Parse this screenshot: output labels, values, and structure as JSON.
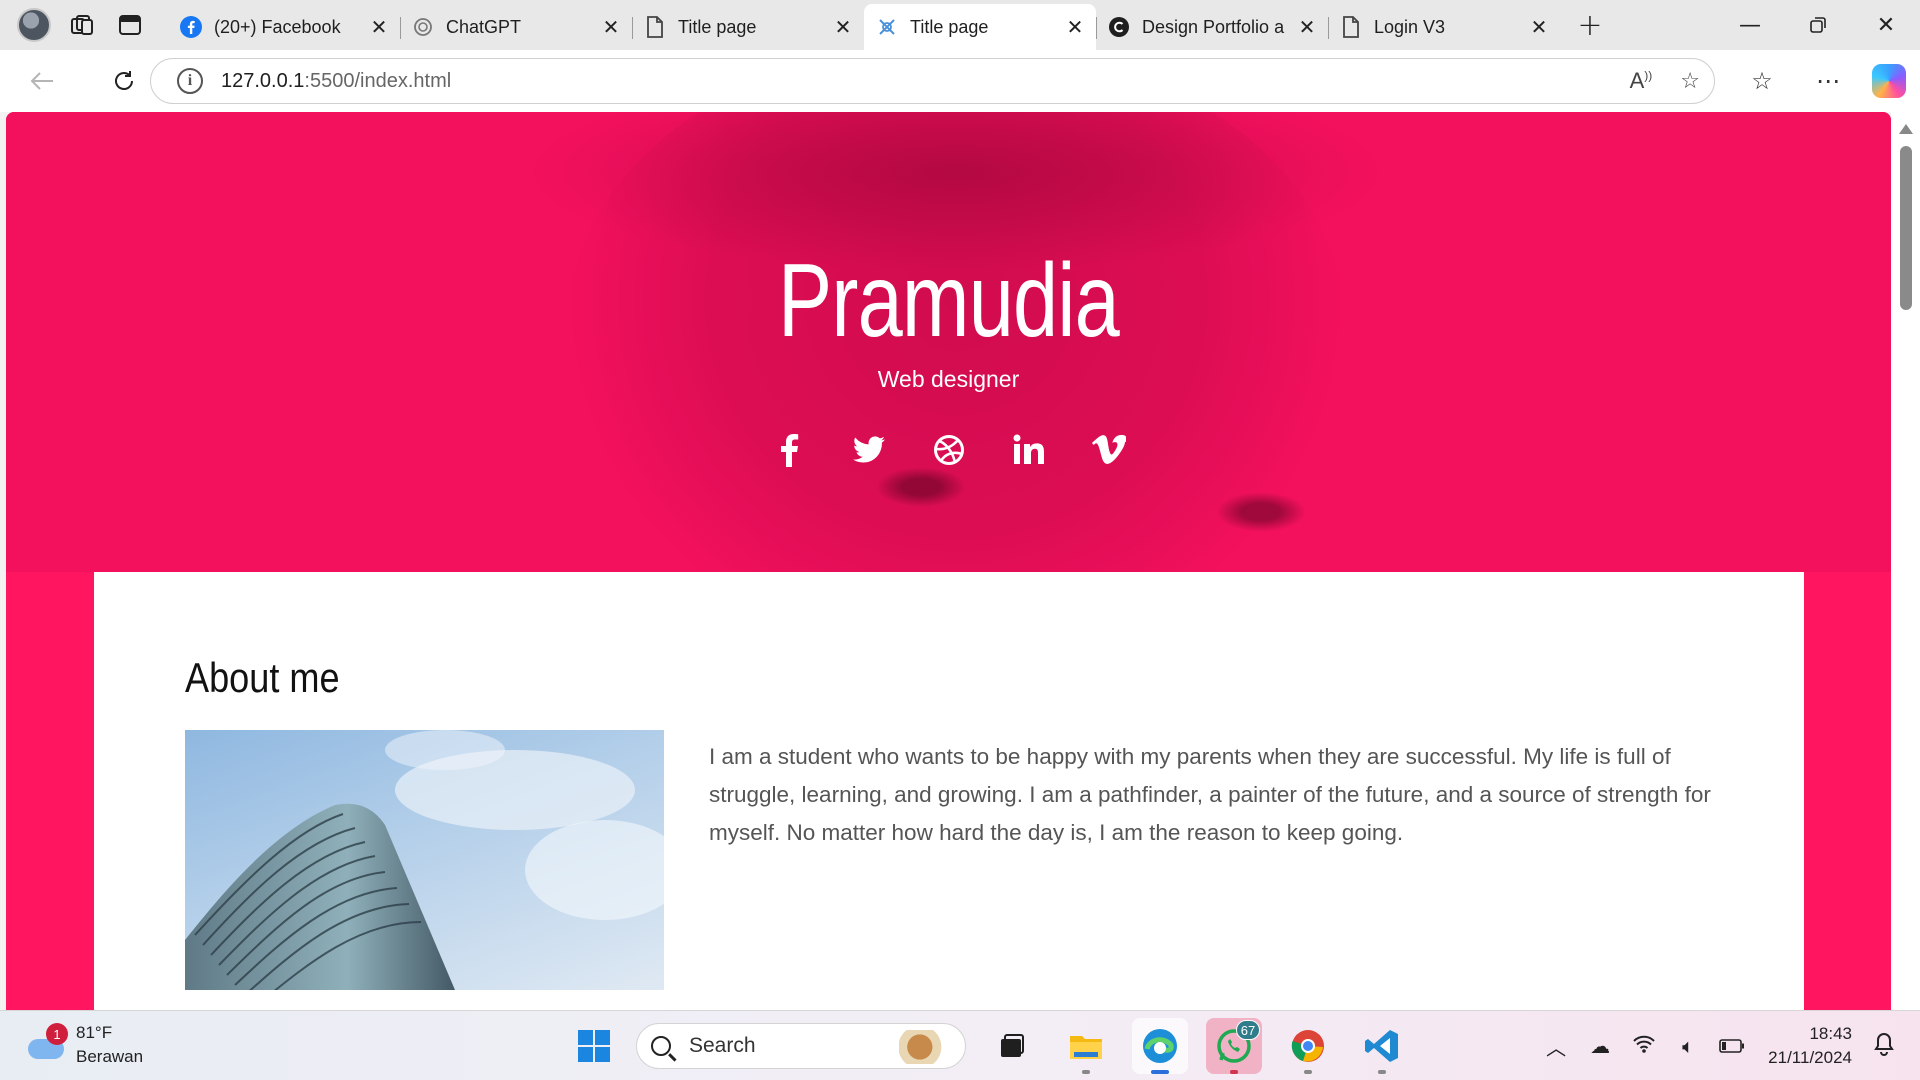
{
  "browser": {
    "tabs": [
      {
        "label": "(20+) Facebook",
        "icon": "facebook-icon",
        "active": false
      },
      {
        "label": "ChatGPT",
        "icon": "chatgpt-icon",
        "active": false
      },
      {
        "label": "Title page",
        "icon": "page-icon",
        "active": false
      },
      {
        "label": "Title page",
        "icon": "vscode-live-icon",
        "active": true
      },
      {
        "label": "Design Portfolio a",
        "icon": "c-logo-icon",
        "active": false
      },
      {
        "label": "Login V3",
        "icon": "page-icon",
        "active": false
      }
    ],
    "address": {
      "host": "127.0.0.1",
      "rest": ":5500/index.html"
    }
  },
  "page": {
    "hero": {
      "name": "Pramudia",
      "subtitle": "Web designer",
      "socials": [
        "facebook-icon",
        "twitter-icon",
        "dribbble-icon",
        "linkedin-icon",
        "vimeo-icon"
      ]
    },
    "about": {
      "heading": "About me",
      "text": "I am a student who wants to be happy with my parents when they are successful. My life is full of struggle, learning, and growing. I am a pathfinder, a painter of the future, and a source of strength for myself. No matter how hard the day is, I am the reason to keep going."
    },
    "colors": {
      "hero": "#f3105d",
      "accent": "#ff1560"
    }
  },
  "taskbar": {
    "weather": {
      "temp": "81°F",
      "condition": "Berawan",
      "badge": "1"
    },
    "search_label": "Search",
    "whatsapp_badge": "67",
    "time": "18:43",
    "date": "21/11/2024"
  }
}
